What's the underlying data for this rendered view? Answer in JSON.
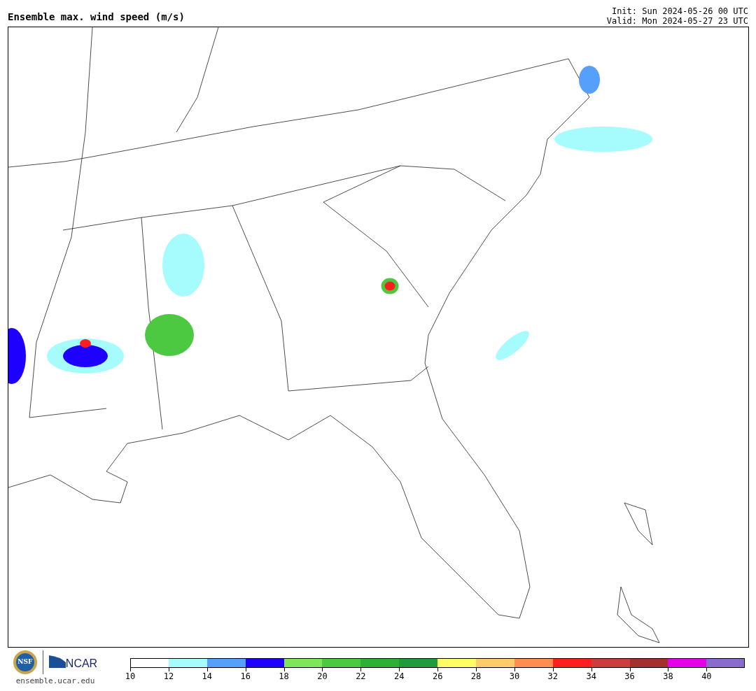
{
  "header": {
    "title": "Ensemble max. wind speed (m/s)",
    "init": "Init: Sun 2024-05-26 00 UTC",
    "valid": "Valid: Mon 2024-05-27 23 UTC"
  },
  "footer": {
    "logo_left": "NSF",
    "logo_right": "NCAR",
    "site": "ensemble.ucar.edu"
  },
  "colorbar": [
    {
      "label": "10",
      "color": "#ffffff"
    },
    {
      "label": "12",
      "color": "#a6fcfc"
    },
    {
      "label": "14",
      "color": "#56a0fc"
    },
    {
      "label": "16",
      "color": "#1e00ff"
    },
    {
      "label": "18",
      "color": "#7de65a"
    },
    {
      "label": "20",
      "color": "#4cc841"
    },
    {
      "label": "22",
      "color": "#2eb036"
    },
    {
      "label": "24",
      "color": "#1f9a3c"
    },
    {
      "label": "26",
      "color": "#fffd63"
    },
    {
      "label": "28",
      "color": "#ffcb6b"
    },
    {
      "label": "30",
      "color": "#ff8c50"
    },
    {
      "label": "32",
      "color": "#ff1e1e"
    },
    {
      "label": "34",
      "color": "#cc3c3c"
    },
    {
      "label": "36",
      "color": "#a32f2f"
    },
    {
      "label": "38",
      "color": "#e600ea"
    },
    {
      "label": "40",
      "color": "#8a6acb"
    }
  ]
}
